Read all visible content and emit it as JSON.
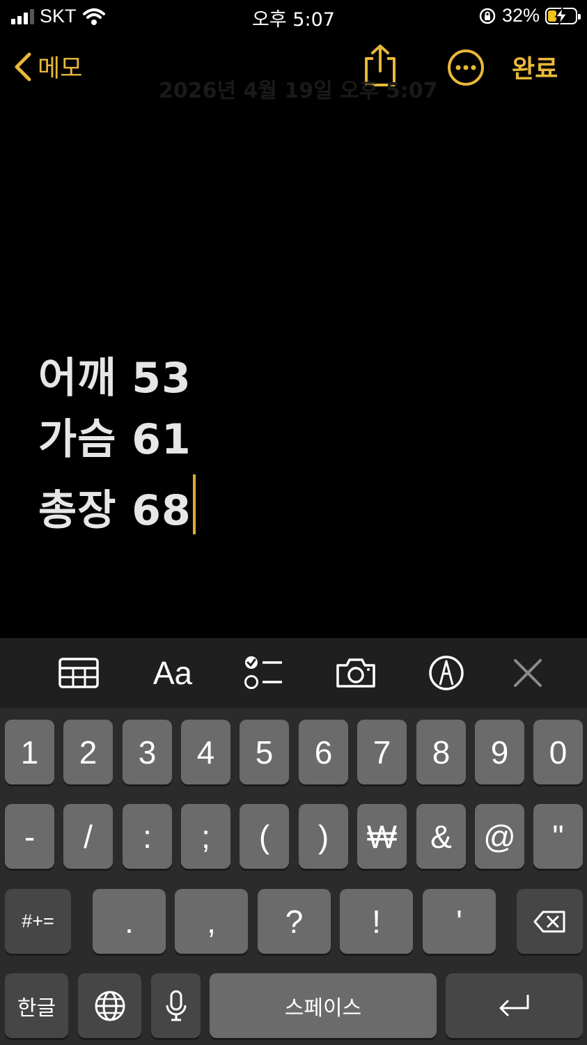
{
  "status_bar": {
    "carrier": "SKT",
    "time": "오후 5:07",
    "battery_percent": "32%",
    "battery_level": 0.32,
    "icons": [
      "signal-icon",
      "wifi-icon",
      "orientation-lock-icon",
      "battery-charging-icon"
    ]
  },
  "nav": {
    "back_label": "메모",
    "done_label": "완료",
    "faded_date": "2026년 4월 19일 오후 5:07"
  },
  "note": {
    "lines": [
      "어깨 53",
      "가슴 61",
      "총장 68"
    ]
  },
  "toolbar": {
    "format_label": "Aa",
    "icons": [
      "table-icon",
      "format-icon",
      "checklist-icon",
      "camera-icon",
      "markup-pen-icon",
      "close-icon"
    ]
  },
  "keyboard": {
    "row1": [
      "1",
      "2",
      "3",
      "4",
      "5",
      "6",
      "7",
      "8",
      "9",
      "0"
    ],
    "row2": [
      "-",
      "/",
      ":",
      ";",
      "(",
      ")",
      "₩",
      "&",
      "@",
      "\""
    ],
    "row3": [
      "#+=",
      ".",
      ",",
      "?",
      "!",
      "'"
    ],
    "row4": {
      "lang_label": "한글",
      "space_label": "스페이스"
    }
  },
  "colors": {
    "accent": "#e9b83a",
    "background": "#000000",
    "toolbar_bg": "#1f1f1f",
    "keyboard_bg": "#2b2b2b",
    "key_bg": "#6b6b6b",
    "key_dark_bg": "#464646"
  }
}
